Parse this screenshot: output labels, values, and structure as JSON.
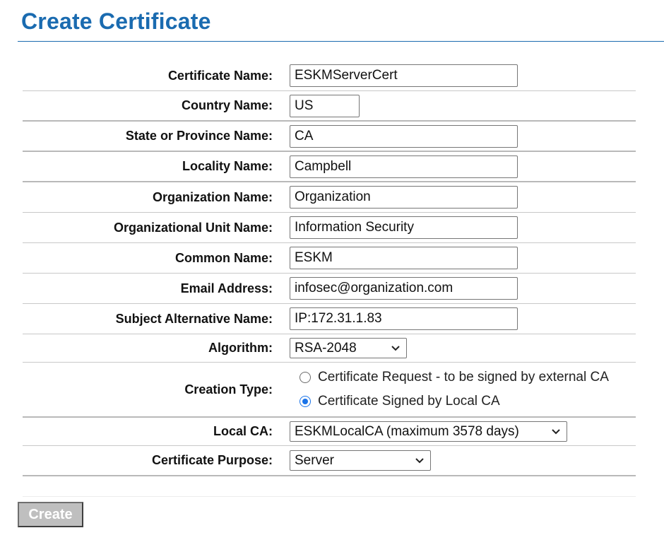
{
  "page": {
    "title": "Create Certificate"
  },
  "form": {
    "certificate_name": {
      "label": "Certificate Name:",
      "value": "ESKMServerCert"
    },
    "country_name": {
      "label": "Country Name:",
      "value": "US"
    },
    "state_name": {
      "label": "State or Province Name:",
      "value": "CA"
    },
    "locality_name": {
      "label": "Locality Name:",
      "value": "Campbell"
    },
    "organization_name": {
      "label": "Organization Name:",
      "value": "Organization"
    },
    "org_unit_name": {
      "label": "Organizational Unit Name:",
      "value": "Information Security"
    },
    "common_name": {
      "label": "Common Name:",
      "value": "ESKM"
    },
    "email_address": {
      "label": "Email Address:",
      "value": "infosec@organization.com"
    },
    "subject_alt_name": {
      "label": "Subject Alternative Name:",
      "value": "IP:172.31.1.83"
    },
    "algorithm": {
      "label": "Algorithm:",
      "selected": "RSA-2048"
    },
    "creation_type": {
      "label": "Creation Type:",
      "options": [
        {
          "label": "Certificate Request - to be signed by external CA",
          "checked": false
        },
        {
          "label": "Certificate Signed by Local CA",
          "checked": true
        }
      ]
    },
    "local_ca": {
      "label": "Local CA:",
      "selected": "ESKMLocalCA (maximum 3578 days)"
    },
    "certificate_purpose": {
      "label": "Certificate Purpose:",
      "selected": "Server"
    }
  },
  "actions": {
    "create_label": "Create"
  },
  "colors": {
    "title": "#1a6bb0",
    "radio_accent": "#1a73e8",
    "button_disabled": "#bfbfbf"
  },
  "icons": {
    "select_arrow": "chevron-down-icon"
  }
}
